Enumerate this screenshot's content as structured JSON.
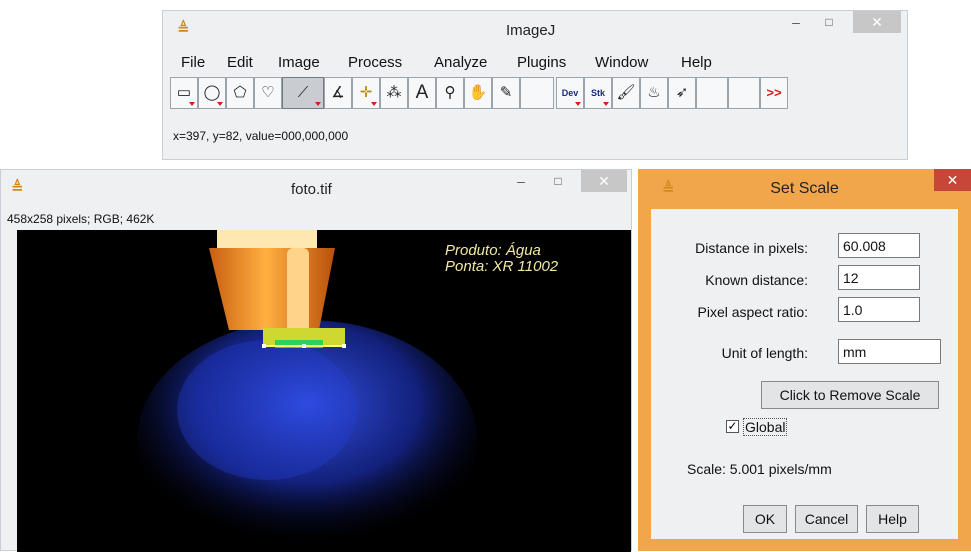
{
  "main_window": {
    "title": "ImageJ",
    "menu": [
      "File",
      "Edit",
      "Image",
      "Process",
      "Analyze",
      "Plugins",
      "Window",
      "Help"
    ],
    "toolbar": {
      "dev_label": "Dev",
      "stk_label": "Stk",
      "more_label": ">>"
    },
    "status": "x=397, y=82, value=000,000,000"
  },
  "image_window": {
    "title": "foto.tif",
    "info": "458x258 pixels; RGB; 462K",
    "caption_line1": "Produto: Água",
    "caption_line2": "Ponta: XR 11002"
  },
  "set_scale": {
    "title": "Set Scale",
    "fields": [
      {
        "label": "Distance in pixels:",
        "value": "60.008"
      },
      {
        "label": "Known distance:",
        "value": "12"
      },
      {
        "label": "Pixel aspect ratio:",
        "value": "1.0"
      },
      {
        "label": "Unit of length:",
        "value": "mm"
      }
    ],
    "remove_scale_label": "Click to Remove Scale",
    "global_label": "Global",
    "global_checked": true,
    "scale_text": "Scale: 5.001 pixels/mm",
    "ok_label": "OK",
    "cancel_label": "Cancel",
    "help_label": "Help"
  },
  "colors": {
    "dialog_border": "#f1a64c",
    "window_bg": "#eef0f2",
    "close_red": "#c7463a",
    "caption": "#f3e9a3"
  }
}
